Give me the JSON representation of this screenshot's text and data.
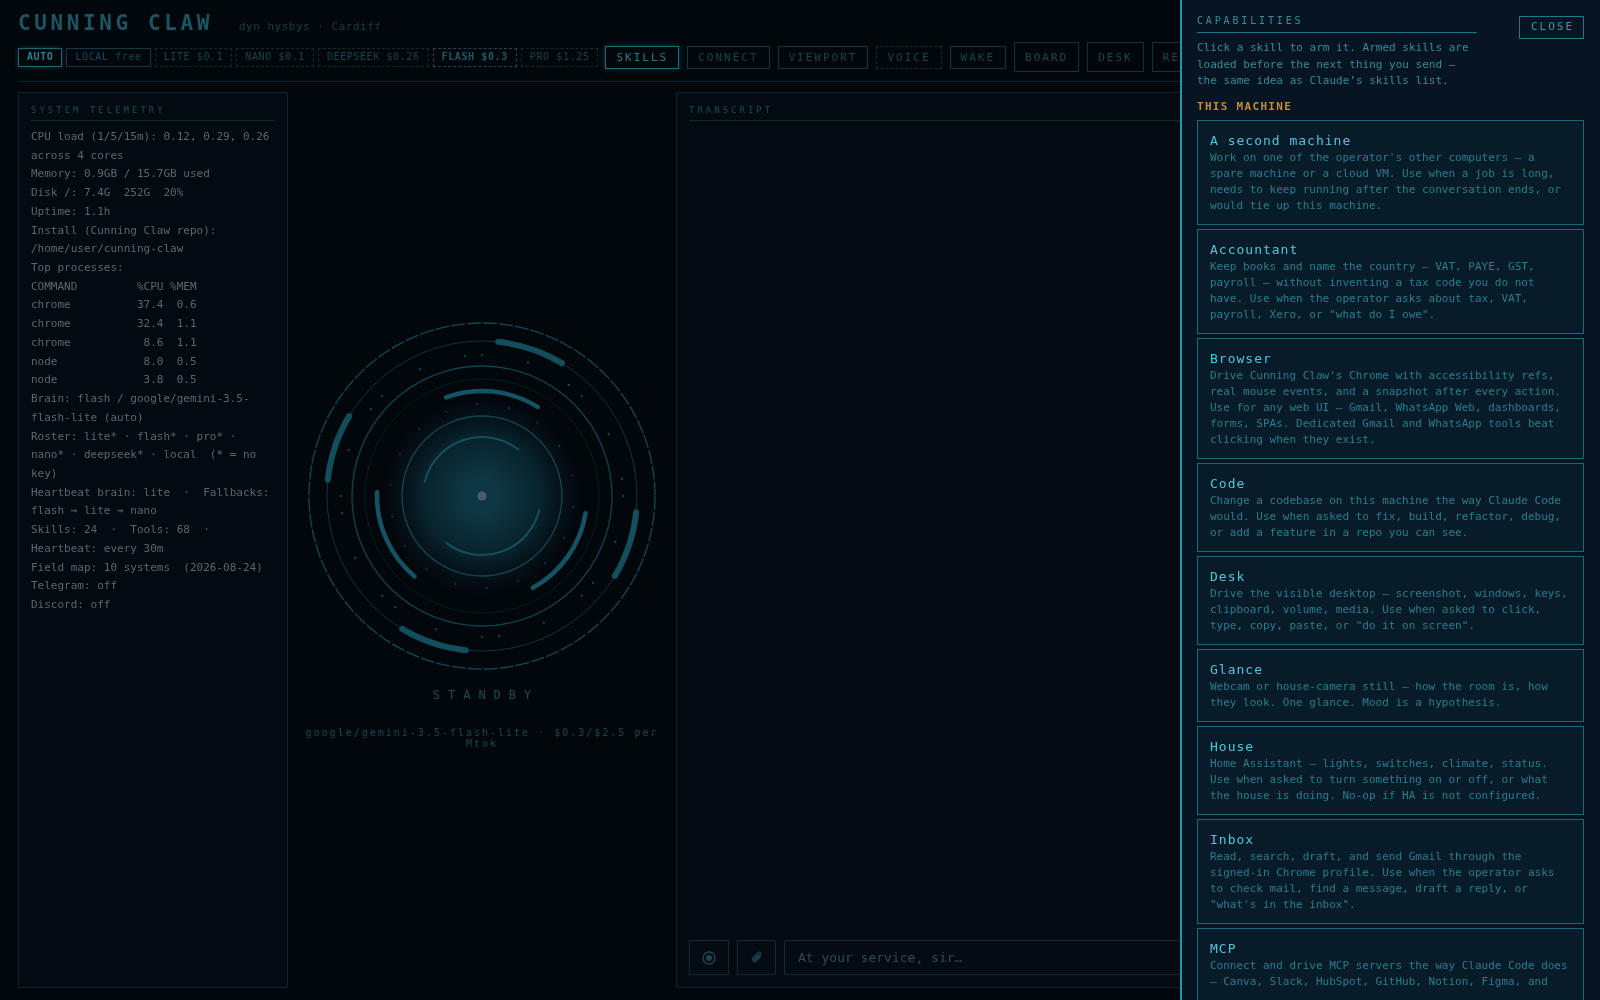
{
  "header": {
    "title": "CUNNING CLAW",
    "subtitle": "dyn hysbys · Cardiff"
  },
  "brain_modes": [
    {
      "label": "AUTO",
      "selected": true,
      "available": true,
      "current": false
    },
    {
      "label": "LOCAL free",
      "selected": false,
      "available": true,
      "current": false
    },
    {
      "label": "LITE $0.1",
      "selected": false,
      "available": false,
      "current": false
    },
    {
      "label": "NANO $0.1",
      "selected": false,
      "available": false,
      "current": false
    },
    {
      "label": "DEEPSEEK $0.26",
      "selected": false,
      "available": false,
      "current": false
    },
    {
      "label": "FLASH $0.3",
      "selected": false,
      "available": false,
      "current": true
    },
    {
      "label": "PRO $1.25",
      "selected": false,
      "available": false,
      "current": false
    }
  ],
  "nav": [
    {
      "label": "SKILLS",
      "kind": "tab",
      "selected": true,
      "available": true
    },
    {
      "label": "CONNECT",
      "kind": "tab",
      "selected": false,
      "available": true
    },
    {
      "label": "VIEWPORT",
      "kind": "tab",
      "selected": false,
      "available": true
    },
    {
      "label": "VOICE",
      "kind": "tab",
      "selected": false,
      "available": false
    },
    {
      "label": "WAKE",
      "kind": "tab",
      "selected": false,
      "available": true
    },
    {
      "label": "BOARD",
      "kind": "panel",
      "selected": false,
      "available": true
    },
    {
      "label": "DESK",
      "kind": "panel",
      "selected": false,
      "available": true
    },
    {
      "label": "RE",
      "kind": "panel",
      "selected": false,
      "available": true
    }
  ],
  "telemetry": {
    "title": "SYSTEM TELEMETRY",
    "lines": [
      "CPU load (1/5/15m): 0.12, 0.29, 0.26 across 4 cores",
      "Memory: 0.9GB / 15.7GB used",
      "Disk /: 7.4G  252G  20%",
      "Uptime: 1.1h",
      "Install (Cunning Claw repo): /home/user/cunning-claw",
      "Top processes:",
      "COMMAND         %CPU %MEM",
      "chrome          37.4  0.6",
      "chrome          32.4  1.1",
      "chrome           8.6  1.1",
      "node             8.0  0.5",
      "node             3.8  0.5",
      "Brain: flash / google/gemini-3.5-flash-lite (auto)",
      "Roster: lite* · flash* · pro* · nano* · deepseek* · local  (* = no key)",
      "Heartbeat brain: lite  ·  Fallbacks: flash → lite → nano",
      "Skills: 24  ·  Tools: 68  ·  Heartbeat: every 30m",
      "Field map: 10 systems  (2026-08-24)",
      "Telegram: off",
      "Discord: off"
    ]
  },
  "orb": {
    "status": "STANDBY",
    "model": "google/gemini-3.5-flash-lite · $0.3/$2.5 per Mtok"
  },
  "transcript": {
    "title": "TRANSCRIPT",
    "input": {
      "placeholder": "At your service, sir…"
    }
  },
  "drawer": {
    "title": "CAPABILITIES",
    "close": "CLOSE",
    "intro": "Click a skill to arm it. Armed skills are loaded before the next thing you send — the same idea as Claude’s skills list.",
    "sections": [
      {
        "heading": "THIS MACHINE",
        "skills": [
          {
            "name": "A second machine",
            "description": "Work on one of the operator's other computers — a spare machine or a cloud VM. Use when a job is long, needs to keep running after the conversation ends, or would tie up this machine."
          },
          {
            "name": "Accountant",
            "description": "Keep books and name the country — VAT, PAYE, GST, payroll — without inventing a tax code you do not have. Use when the operator asks about tax, VAT, payroll, Xero, or \"what do I owe\"."
          },
          {
            "name": "Browser",
            "description": "Drive Cunning Claw's Chrome with accessibility refs, real mouse events, and a snapshot after every action. Use for any web UI — Gmail, WhatsApp Web, dashboards, forms, SPAs. Dedicated Gmail and WhatsApp tools beat clicking when they exist."
          },
          {
            "name": "Code",
            "description": "Change a codebase on this machine the way Claude Code would. Use when asked to fix, build, refactor, debug, or add a feature in a repo you can see."
          },
          {
            "name": "Desk",
            "description": "Drive the visible desktop — screenshot, windows, keys, clipboard, volume, media. Use when asked to click, type, copy, paste, or \"do it on screen\"."
          },
          {
            "name": "Glance",
            "description": "Webcam or house-camera still — how the room is, how they look. One glance. Mood is a hypothesis."
          },
          {
            "name": "House",
            "description": "Home Assistant — lights, switches, climate, status. Use when asked to turn something on or off, or what the house is doing. No-op if HA is not configured."
          },
          {
            "name": "Inbox",
            "description": "Read, search, draft, and send Gmail through the signed-in Chrome profile. Use when the operator asks to check mail, find a message, draft a reply, or \"what's in the inbox\"."
          },
          {
            "name": "MCP",
            "description": "Connect and drive MCP servers the way Claude Code does — Canva, Slack, HubSpot, GitHub, Notion, Figma, and"
          }
        ]
      }
    ]
  }
}
